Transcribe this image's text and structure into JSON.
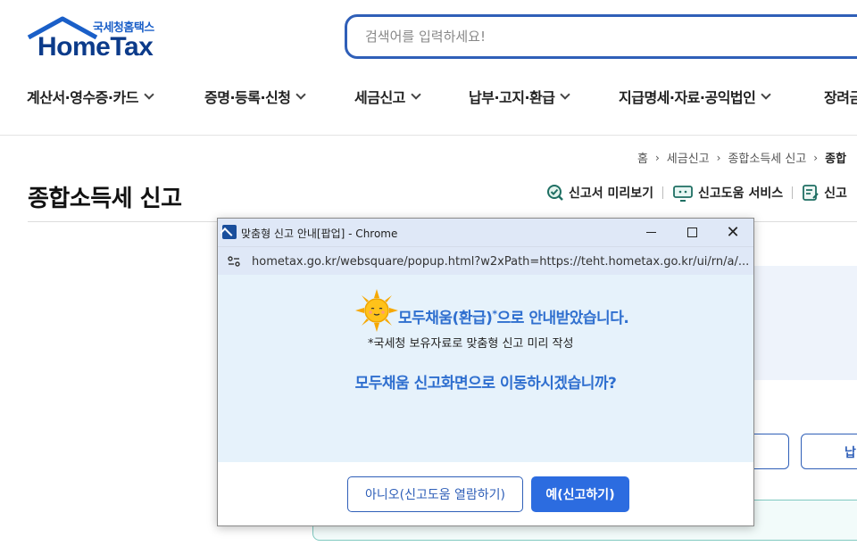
{
  "header": {
    "logo_sub": "국세청홈택스",
    "logo_main": "HomeTax",
    "search_placeholder": "검색어를 입력하세요!"
  },
  "gnb": [
    {
      "label": "계산서·영수증·카드"
    },
    {
      "label": "증명·등록·신청"
    },
    {
      "label": "세금신고"
    },
    {
      "label": "납부·고지·환급"
    },
    {
      "label": "지급명세·자료·공익법인"
    },
    {
      "label": "장려금"
    }
  ],
  "breadcrumb": {
    "items": [
      "홈",
      "세금신고",
      "종합소득세 신고",
      "종합"
    ]
  },
  "page": {
    "title": "종합소득세 신고",
    "tools": [
      "신고서 미리보기",
      "신고도움 서비스",
      "신고"
    ]
  },
  "background": {
    "btn2_label": "납"
  },
  "popup": {
    "window_title": "맞춤형 신고 안내[팝업] - Chrome",
    "url": "hometax.go.kr/websquare/popup.html?w2xPath=https://teht.hometax.go.kr/ui/rn/a/...",
    "headline": "모두채움(환급)",
    "headline_mark": "*",
    "headline_tail": "으로 안내받았습니다.",
    "note": "*국세청 보유자료로 맞춤형 신고 미리 작성",
    "question": "모두채움 신고화면으로 이동하시겠습니까?",
    "btn_no": "아니오(신고도움 열람하기)",
    "btn_yes": "예(신고하기)"
  },
  "colors": {
    "brand_blue": "#2f5fb8",
    "accent_blue": "#2f6fcf",
    "button_blue": "#2c6ce0",
    "popup_bg": "#e6f2fb"
  }
}
